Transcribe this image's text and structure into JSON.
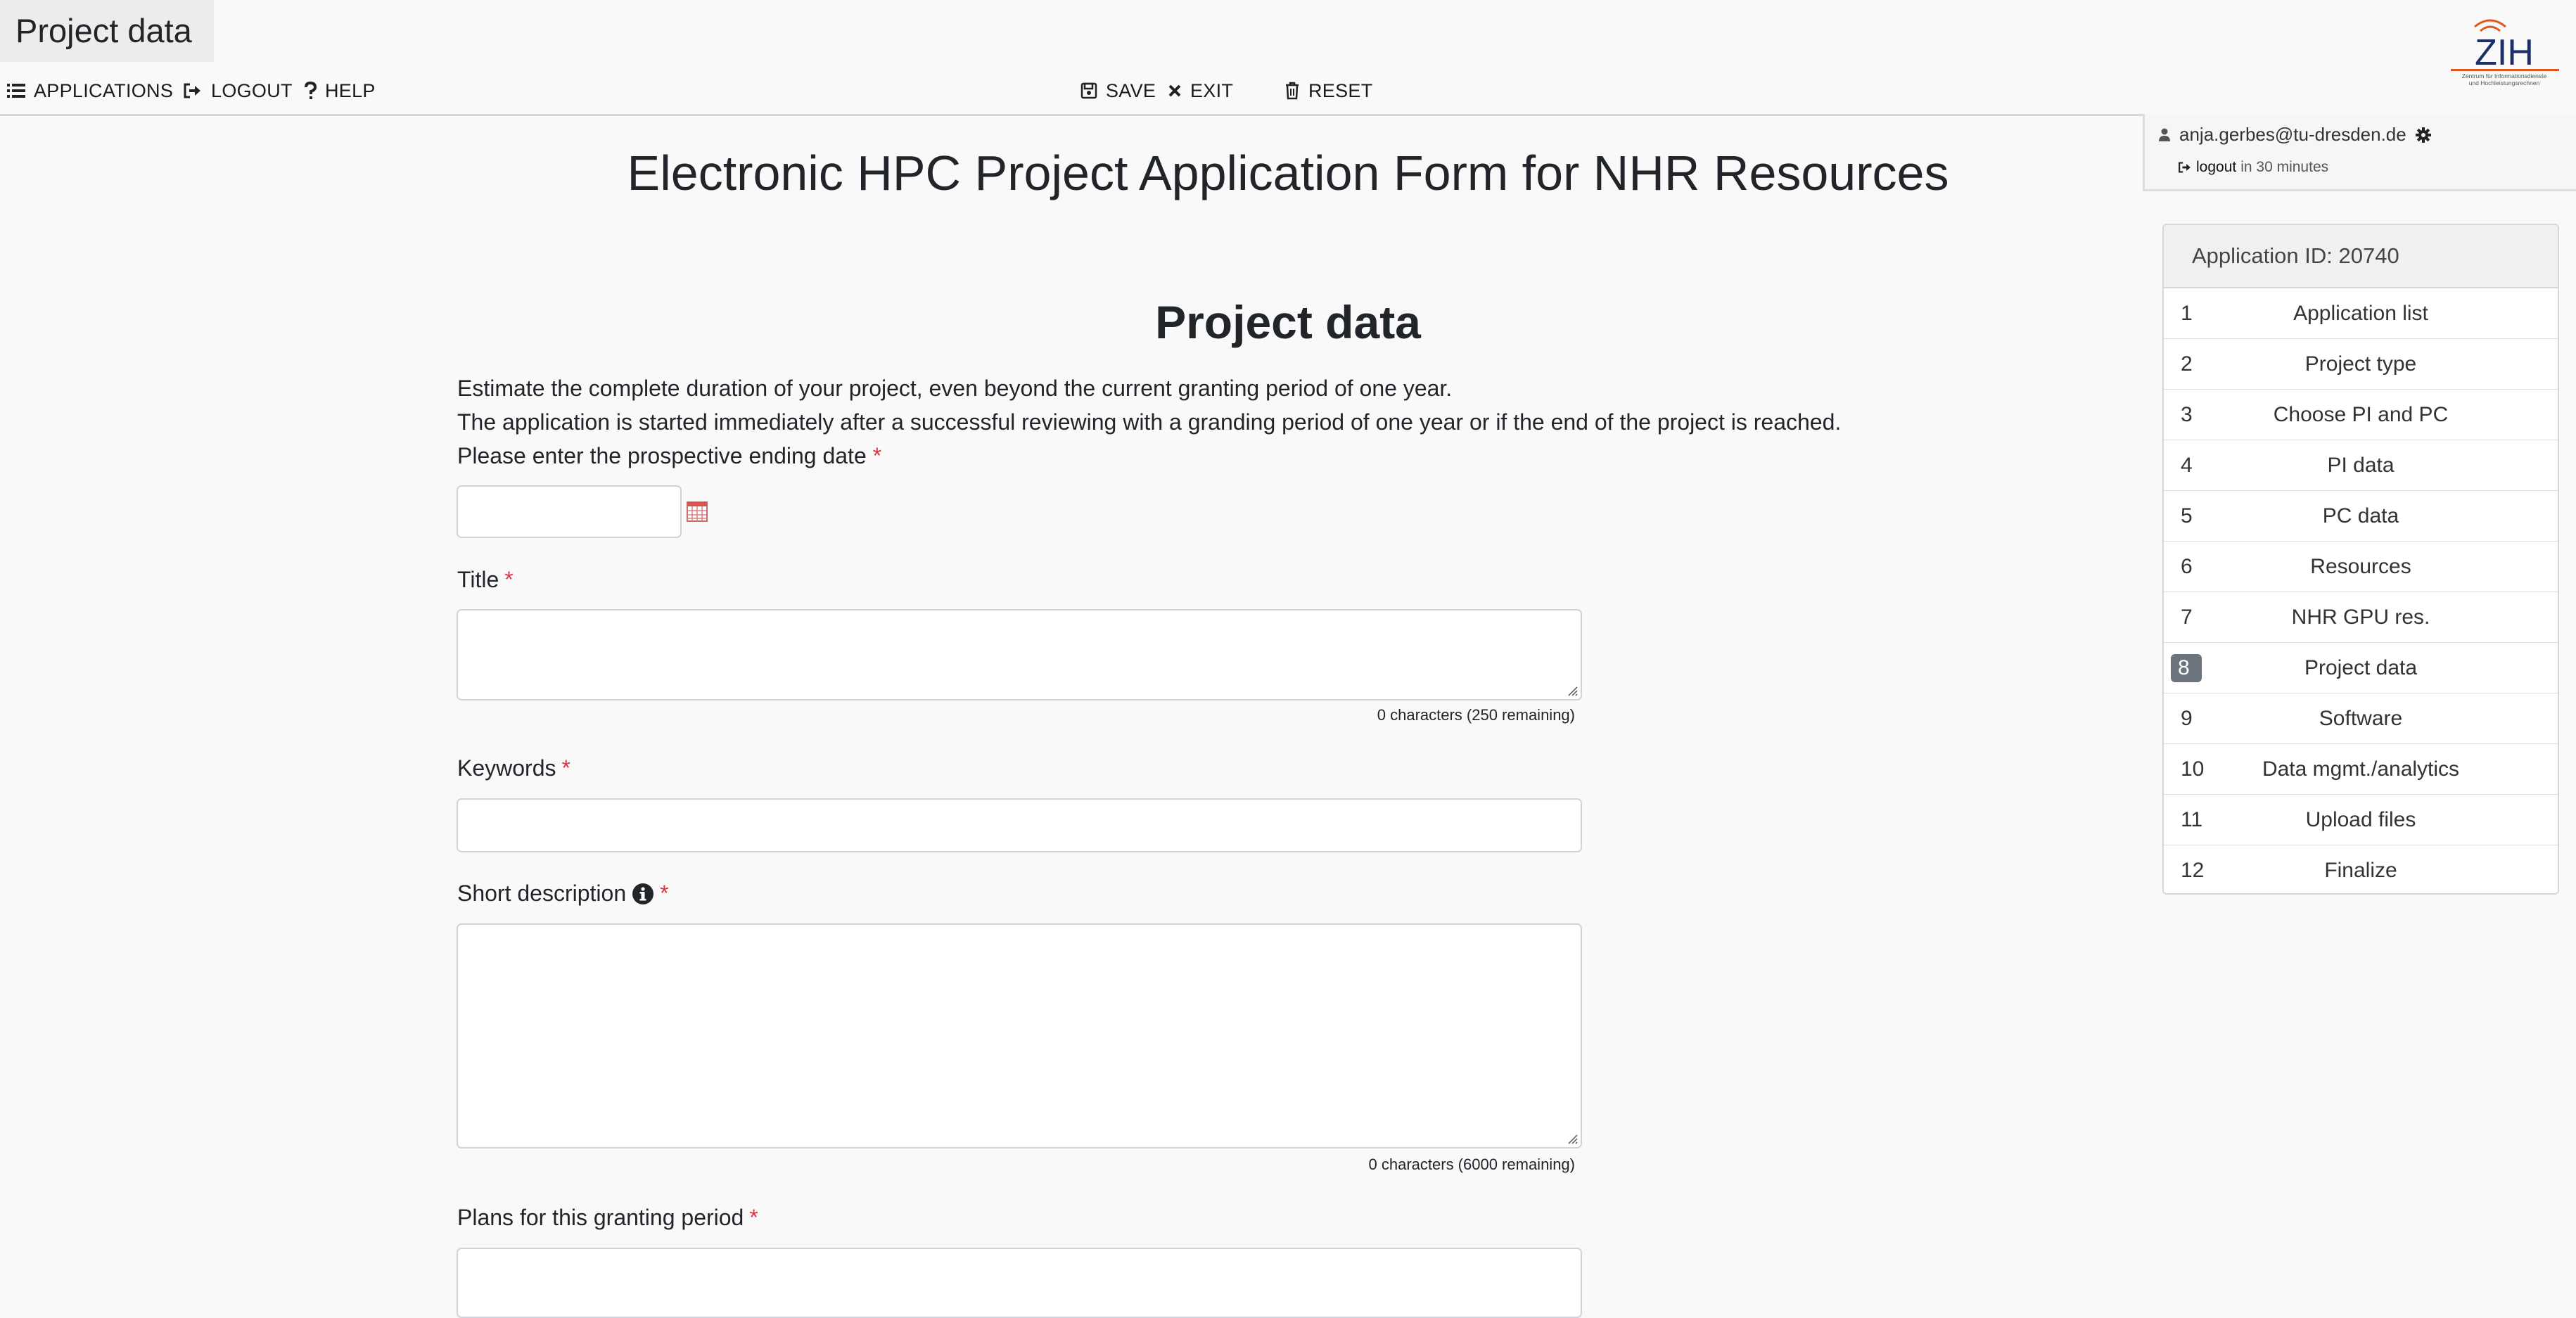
{
  "header": {
    "page_tab": "Project data",
    "nav": [
      {
        "label": "APPLICATIONS",
        "icon": "list-icon"
      },
      {
        "label": "LOGOUT",
        "icon": "sign-out-icon"
      },
      {
        "label": "HELP",
        "icon": "question-icon"
      }
    ],
    "actions": [
      {
        "label": "SAVE",
        "icon": "save-icon"
      },
      {
        "label": "EXIT",
        "icon": "times-icon"
      },
      {
        "label": "RESET",
        "icon": "trash-icon"
      }
    ]
  },
  "user": {
    "email": "anja.gerbes@tu-dresden.de",
    "logout_link": "logout",
    "logout_suffix": "in 30 minutes"
  },
  "logo": {
    "text": "ZIH",
    "subtitle_line1": "Zentrum für Informationsdienste",
    "subtitle_line2": "und Hochleistungsrechnen",
    "accent_color": "#e2571e"
  },
  "main_title": "Electronic HPC Project Application Form for NHR Resources",
  "section_title": "Project data",
  "intro": {
    "line1": "Estimate the complete duration of your project, even beyond the current granting period of one year.",
    "line2": "The application is started immediately after a successful reviewing with a granding period of one year or if the end of the project is reached.",
    "line3": "Please enter the prospective ending date"
  },
  "required_mark": "*",
  "fields": {
    "end_date": {
      "value": ""
    },
    "title": {
      "label": "Title",
      "value": "",
      "counter": "0 characters (250 remaining)"
    },
    "keywords": {
      "label": "Keywords",
      "value": ""
    },
    "short_description": {
      "label": "Short description",
      "value": "",
      "counter": "0 characters (6000 remaining)"
    },
    "plans": {
      "label": "Plans for this granting period",
      "value": ""
    }
  },
  "sidebar": {
    "header": "Application ID: 20740",
    "active_step": 8,
    "items": [
      {
        "num": "1",
        "label": "Application list"
      },
      {
        "num": "2",
        "label": "Project type"
      },
      {
        "num": "3",
        "label": "Choose PI and PC"
      },
      {
        "num": "4",
        "label": "PI data"
      },
      {
        "num": "5",
        "label": "PC data"
      },
      {
        "num": "6",
        "label": "Resources"
      },
      {
        "num": "7",
        "label": "NHR GPU res."
      },
      {
        "num": "8",
        "label": "Project data"
      },
      {
        "num": "9",
        "label": "Software"
      },
      {
        "num": "10",
        "label": "Data mgmt./analytics"
      },
      {
        "num": "11",
        "label": "Upload files"
      },
      {
        "num": "12",
        "label": "Finalize"
      }
    ]
  },
  "colors": {
    "background": "#f9f9f9",
    "required": "#dc3545",
    "active_badge": "#6c757d"
  }
}
